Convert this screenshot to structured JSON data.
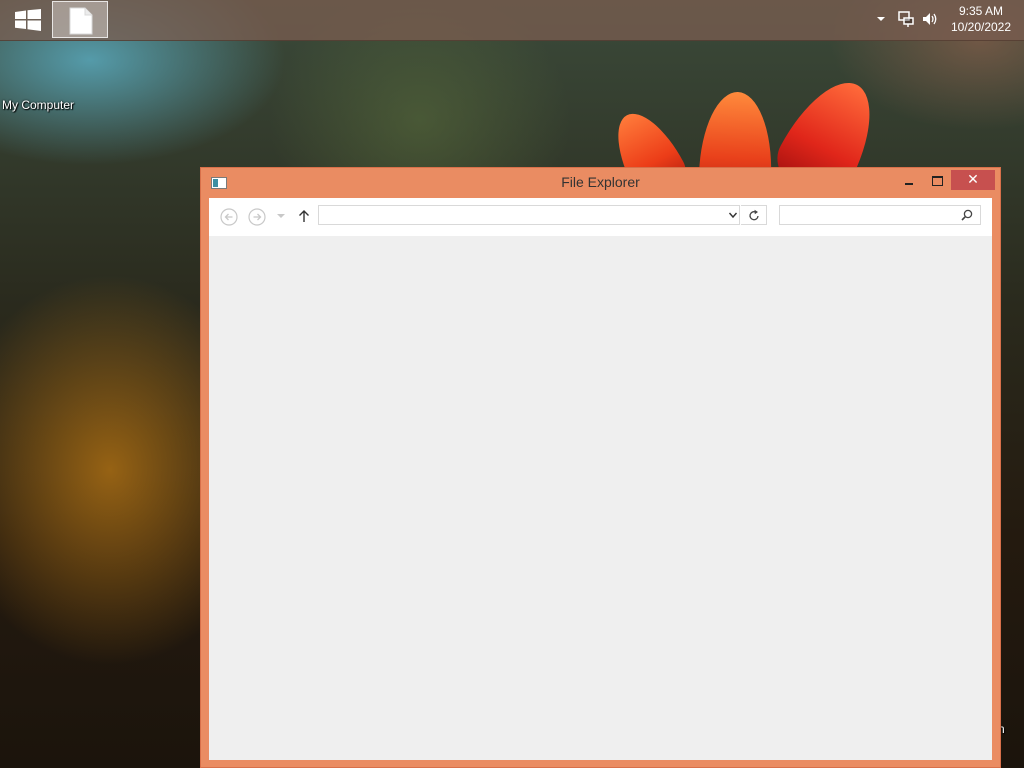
{
  "taskbar": {
    "start": {
      "icon": "windows-logo-icon"
    },
    "items": [
      {
        "icon": "document-icon",
        "active": true
      }
    ],
    "tray": {
      "icons": [
        "chevron-up-icon",
        "network-icon",
        "volume-icon"
      ],
      "time": "9:35 AM",
      "date": "10/20/2022"
    }
  },
  "desktop": {
    "icons": [
      {
        "label": "My Computer"
      }
    ],
    "edge_text": "n"
  },
  "window": {
    "title": "File Explorer",
    "controls": [
      "minimize",
      "maximize",
      "close"
    ],
    "close_glyph": "✕",
    "nav": {
      "address_value": "",
      "search_placeholder": ""
    }
  },
  "colors": {
    "window_frame": "#ea8c62",
    "close_button": "#c7504f",
    "client_bg": "#efefef",
    "taskbar": "#785c50"
  }
}
